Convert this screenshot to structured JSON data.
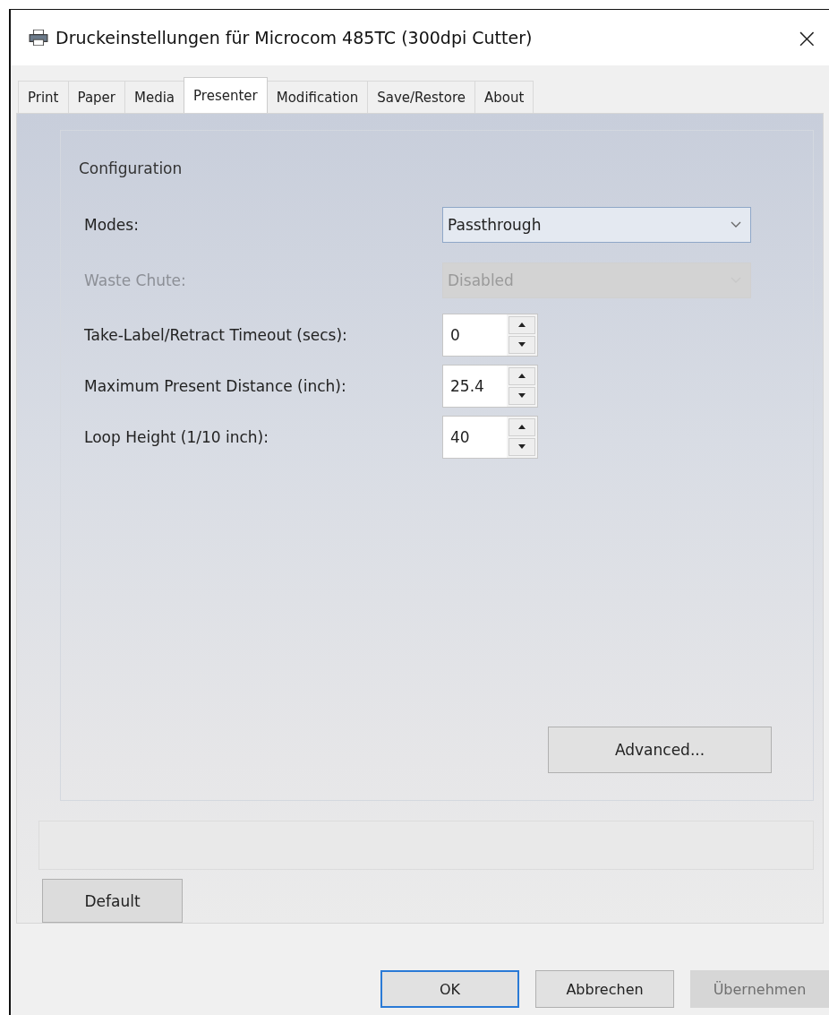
{
  "window": {
    "title": "Druckeinstellungen für Microcom 485TC (300dpi Cutter)",
    "close": "×"
  },
  "tabs": [
    {
      "label": "Print",
      "selected": false
    },
    {
      "label": "Paper",
      "selected": false
    },
    {
      "label": "Media",
      "selected": false
    },
    {
      "label": "Presenter",
      "selected": true
    },
    {
      "label": "Modification",
      "selected": false
    },
    {
      "label": "Save/Restore",
      "selected": false
    },
    {
      "label": "About",
      "selected": false
    }
  ],
  "group": {
    "title": "Configuration"
  },
  "fields": [
    {
      "kind": "dropdown",
      "label": "Modes:",
      "value": "Passthrough",
      "disabled": false
    },
    {
      "kind": "dropdown",
      "label": "Waste Chute:",
      "value": "Disabled",
      "disabled": true
    },
    {
      "kind": "spinner",
      "label": "Take-Label/Retract Timeout (secs):",
      "value": "0",
      "disabled": false
    },
    {
      "kind": "spinner",
      "label": "Maximum Present Distance (inch):",
      "value": "25.4",
      "disabled": false
    },
    {
      "kind": "spinner",
      "label": "Loop Height (1/10 inch):",
      "value": "40",
      "disabled": false
    }
  ],
  "advanced_button": "Advanced...",
  "default_button": "Default",
  "buttons": [
    {
      "label": "OK",
      "default": true,
      "disabled": false
    },
    {
      "label": "Abbrechen",
      "default": false,
      "disabled": false
    },
    {
      "label": "Übernehmen",
      "default": false,
      "disabled": true
    }
  ]
}
